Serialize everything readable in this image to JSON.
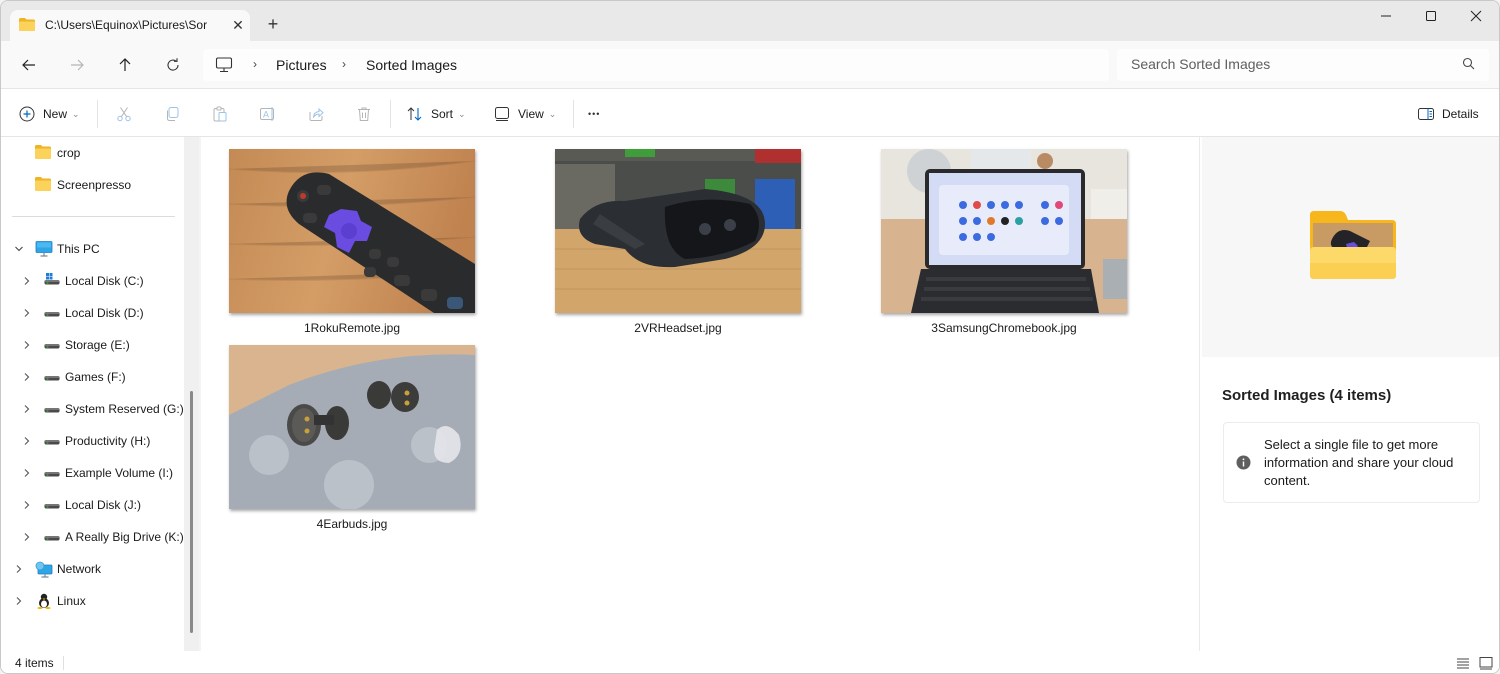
{
  "window": {
    "tab_title": "C:\\Users\\Equinox\\Pictures\\Sorted Images",
    "tab_title_visible": "C:\\Users\\Equinox\\Pictures\\Sor",
    "close_tab_glyph": "✕",
    "new_tab_glyph": "+"
  },
  "nav": {
    "breadcrumb": [
      "Pictures",
      "Sorted Images"
    ],
    "breadcrumb_sep": "›",
    "search_placeholder": "Search Sorted Images"
  },
  "toolbar": {
    "new_label": "New",
    "sort_label": "Sort",
    "view_label": "View",
    "more_glyph": "•••",
    "details_label": "Details",
    "caret_glyph": "⌄"
  },
  "sidebar": {
    "quick_items": [
      {
        "label": "crop",
        "icon": "folder-icon"
      },
      {
        "label": "Screenpresso",
        "icon": "folder-icon"
      }
    ],
    "this_pc": {
      "label": "This PC",
      "expanded": true
    },
    "drives": [
      {
        "label": "Local Disk (C:)",
        "icon": "windows-drive-icon"
      },
      {
        "label": "Local Disk (D:)",
        "icon": "drive-icon"
      },
      {
        "label": "Storage (E:)",
        "icon": "drive-icon"
      },
      {
        "label": "Games (F:)",
        "icon": "drive-icon"
      },
      {
        "label": "System Reserved (G:)",
        "icon": "drive-icon"
      },
      {
        "label": "Productivity (H:)",
        "icon": "drive-icon"
      },
      {
        "label": "Example Volume (I:)",
        "icon": "drive-icon"
      },
      {
        "label": "Local Disk (J:)",
        "icon": "drive-icon"
      },
      {
        "label": "A Really Big Drive (K:)",
        "icon": "drive-icon"
      }
    ],
    "network": {
      "label": "Network"
    },
    "linux": {
      "label": "Linux"
    }
  },
  "files": [
    {
      "name": "1RokuRemote.jpg",
      "subject": "roku-remote"
    },
    {
      "name": "2VRHeadset.jpg",
      "subject": "vr-headset"
    },
    {
      "name": "3SamsungChromebook.jpg",
      "subject": "chromebook"
    },
    {
      "name": "4Earbuds.jpg",
      "subject": "earbuds"
    }
  ],
  "details": {
    "title": "Sorted Images (4 items)",
    "info": "Select a single file to get more information and share your cloud content."
  },
  "status": {
    "item_count": "4 items"
  },
  "colors": {
    "accent": "#0067c0",
    "folder": "#f8c543",
    "folder_dark": "#e8a918"
  }
}
